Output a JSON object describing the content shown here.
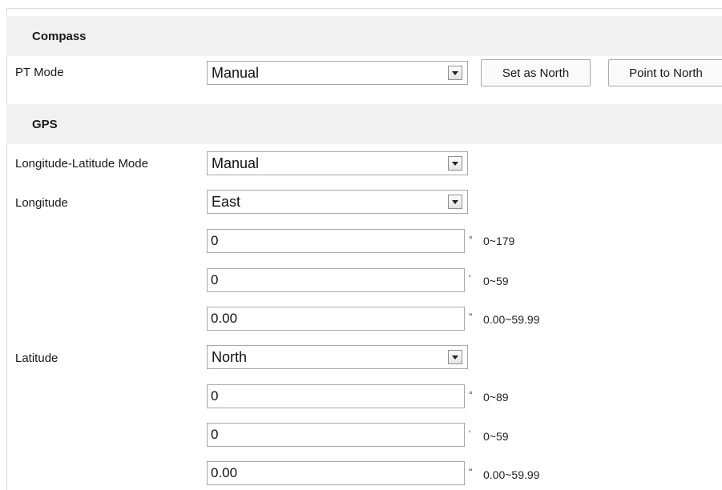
{
  "compass": {
    "header": "Compass",
    "pt_mode_label": "PT Mode",
    "pt_mode_value": "Manual",
    "set_north_label": "Set as North",
    "point_north_label": "Point to North"
  },
  "gps": {
    "header": "GPS",
    "mode_label": "Longitude-Latitude Mode",
    "mode_value": "Manual",
    "longitude": {
      "label": "Longitude",
      "direction": "East",
      "degrees": "0",
      "degrees_unit": "°",
      "degrees_range": "0~179",
      "minutes": "0",
      "minutes_unit": "'",
      "minutes_range": "0~59",
      "seconds": "0.00",
      "seconds_unit": "\"",
      "seconds_range": "0.00~59.99"
    },
    "latitude": {
      "label": "Latitude",
      "direction": "North",
      "degrees": "0",
      "degrees_unit": "°",
      "degrees_range": "0~89",
      "minutes": "0",
      "minutes_unit": "'",
      "minutes_range": "0~59",
      "seconds": "0.00",
      "seconds_unit": "\"",
      "seconds_range": "0.00~59.99"
    }
  }
}
